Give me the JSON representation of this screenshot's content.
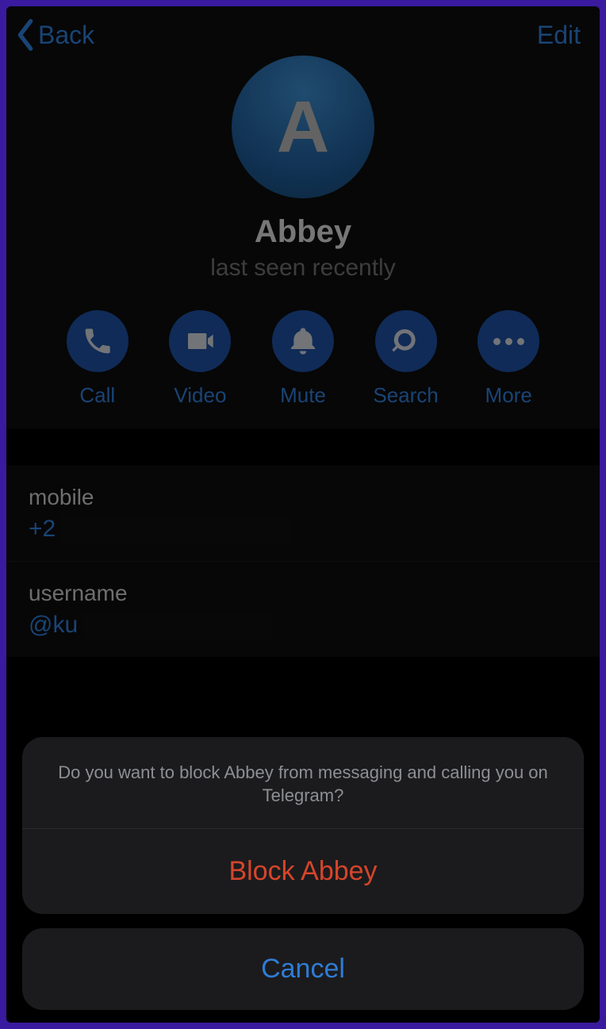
{
  "header": {
    "back_label": "Back",
    "edit_label": "Edit"
  },
  "profile": {
    "avatar_initial": "A",
    "name": "Abbey",
    "status": "last seen recently"
  },
  "actions": {
    "call": "Call",
    "video": "Video",
    "mute": "Mute",
    "search": "Search",
    "more": "More"
  },
  "info": {
    "mobile_label": "mobile",
    "mobile_value": "+2",
    "username_label": "username",
    "username_value": "@ku"
  },
  "sheet": {
    "message": "Do you want to block Abbey from messaging and calling you on Telegram?",
    "block_label": "Block Abbey",
    "cancel_label": "Cancel"
  }
}
